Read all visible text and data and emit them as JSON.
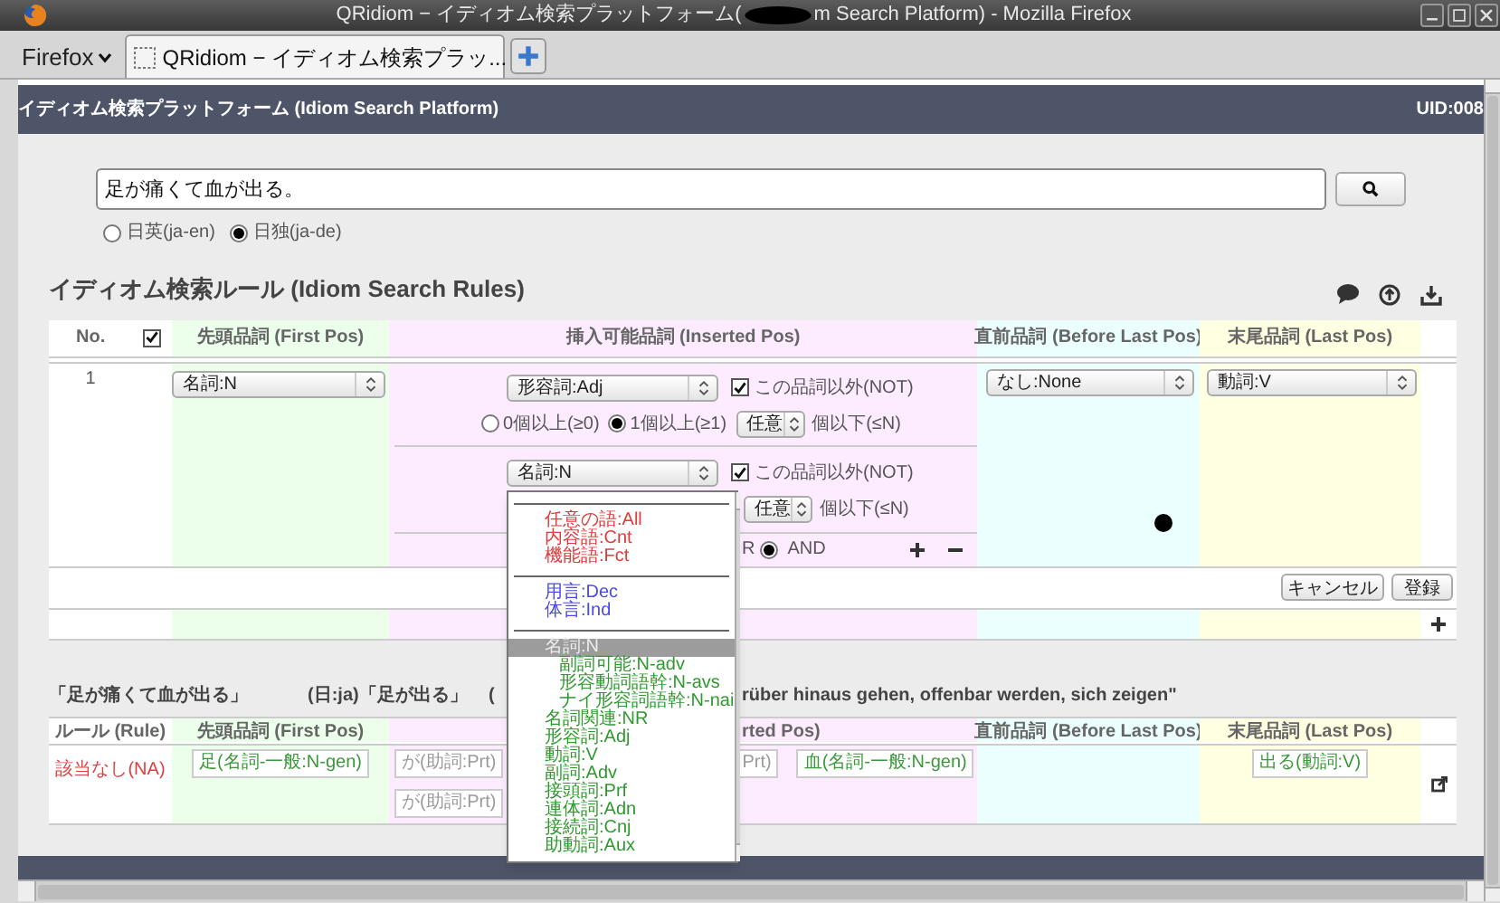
{
  "window": {
    "title_start": "QRidiom − イディオム検索プラットフォーム(",
    "title_end": "m Search Platform) - Mozilla Firefox"
  },
  "browser": {
    "menu": "Firefox",
    "tabs": [
      {
        "label": "QRidiom − イディオム検索プラッ...",
        "selected": true
      }
    ]
  },
  "header": {
    "title": "イディオム検索プラットフォーム (Idiom Search Platform)",
    "uid": "UID:008"
  },
  "search": {
    "value": "足が痛くて血が出る。",
    "languages": [
      {
        "label": "日英(ja-en)",
        "selected": false
      },
      {
        "label": "日独(ja-de)",
        "selected": true
      }
    ]
  },
  "rules": {
    "title": "イディオム検索ルール (Idiom Search Rules)",
    "select_all_checked": true,
    "columns": [
      "No.",
      "先頭品詞 (First Pos)",
      "挿入可能品詞 (Inserted Pos)",
      "直前品詞 (Before Last Pos)",
      "末尾品詞 (Last Pos)"
    ],
    "rows": [
      {
        "no": "1",
        "first_pos": "名詞:N",
        "inserted": [
          {
            "pos": "形容詞:Adj",
            "not_checked": true,
            "not_label": "この品詞以外(NOT)",
            "counts": [
              {
                "label": "0個以上(≥0)",
                "selected": false
              },
              {
                "label": "1個以上(≥1)",
                "selected": true
              }
            ],
            "max": "任意",
            "max_label": "個以下(≤N)"
          },
          {
            "pos": "名詞:N",
            "not_checked": true,
            "not_label": "この品詞以外(NOT)",
            "max": "任意",
            "max_label": "個以下(≤N)"
          }
        ],
        "join": {
          "partial_label": "R",
          "options": [
            {
              "label": "AND",
              "selected": true
            }
          ]
        },
        "before_last": "なし:None",
        "last": "動詞:V"
      }
    ],
    "buttons": [
      "キャンセル",
      "登録"
    ]
  },
  "dropdown": {
    "options": [
      {
        "kind": "separator"
      },
      {
        "kind": "option",
        "label": "任意の語:All",
        "color": "#e03a3a",
        "selected": false
      },
      {
        "kind": "option",
        "label": "内容語:Cnt",
        "color": "#e03a3a",
        "selected": false
      },
      {
        "kind": "option",
        "label": "機能語:Fct",
        "color": "#e03a3a",
        "selected": false
      },
      {
        "kind": "separator"
      },
      {
        "kind": "option",
        "label": "用言:Dec",
        "color": "#4a4ae8",
        "selected": false
      },
      {
        "kind": "option",
        "label": "体言:Ind",
        "color": "#4a4ae8",
        "selected": false
      },
      {
        "kind": "separator"
      },
      {
        "kind": "option",
        "label": "名詞:N",
        "selected": true,
        "children": [
          {
            "kind": "option",
            "label": "副詞可能:N-adv",
            "color": "#2e9a2e",
            "selected": false
          },
          {
            "kind": "option",
            "label": "形容動詞語幹:N-avs",
            "color": "#2e9a2e",
            "selected": false
          },
          {
            "kind": "option",
            "label": "ナイ形容詞語幹:N-nai",
            "color": "#2e9a2e",
            "selected": false
          }
        ]
      },
      {
        "kind": "option",
        "label": "名詞関連:NR",
        "color": "#2e9a2e",
        "selected": false
      },
      {
        "kind": "option",
        "label": "形容詞:Adj",
        "color": "#2e9a2e",
        "selected": false
      },
      {
        "kind": "option",
        "label": "動詞:V",
        "color": "#2e9a2e",
        "selected": false
      },
      {
        "kind": "option",
        "label": "副詞:Adv",
        "color": "#2e9a2e",
        "selected": false
      },
      {
        "kind": "option",
        "label": "接頭詞:Prf",
        "color": "#2e9a2e",
        "selected": false
      },
      {
        "kind": "option",
        "label": "連体詞:Adn",
        "color": "#2e9a2e",
        "selected": false
      },
      {
        "kind": "option",
        "label": "接続詞:Cnj",
        "color": "#2e9a2e",
        "selected": false
      },
      {
        "kind": "option",
        "label": "助動詞:Aux",
        "color": "#2e9a2e",
        "selected": false
      }
    ]
  },
  "results": {
    "sentence": "「足が痛くて血が出る」",
    "idiom": "(日:ja)「足が出る」",
    "open_paren": "(",
    "meaning": "rüber hinaus gehen, offenbar werden, sich zeigen\"",
    "columns": [
      "ルール (Rule)",
      "先頭品詞 (First Pos)",
      "rted Pos)",
      "直前品詞 (Before Last Pos)",
      "末尾品詞 (Last Pos)"
    ],
    "rows": [
      {
        "rule": "該当なし(NA)",
        "first_pos": {
          "label": "足(名詞-一般:N-gen)",
          "kind": "content"
        },
        "inserted": [
          [
            {
              "label": "が(助詞:Prt)",
              "kind": "function"
            },
            {
              "label": "Prt)",
              "kind": "function",
              "partial": true
            },
            {
              "label": "血(名詞-一般:N-gen)",
              "kind": "content"
            }
          ],
          [
            {
              "label": "が(助詞:Prt)",
              "kind": "function"
            }
          ]
        ],
        "before_last": [],
        "last": {
          "label": "出る(動詞:V)",
          "kind": "content"
        }
      }
    ]
  }
}
